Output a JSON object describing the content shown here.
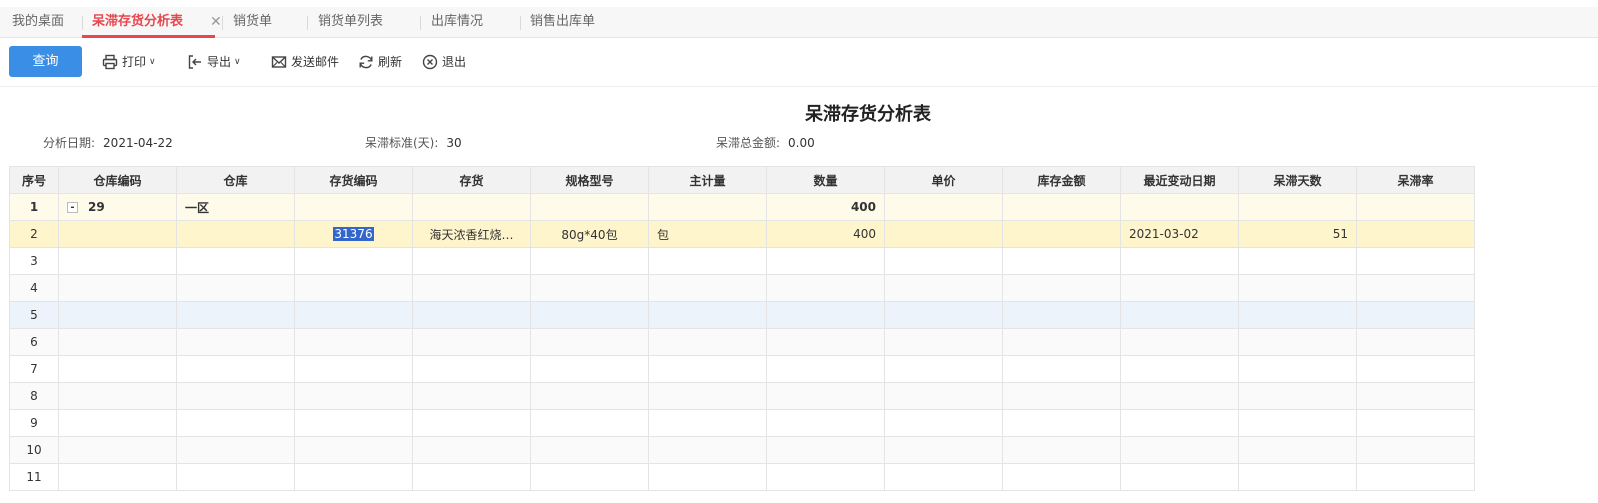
{
  "tabs": [
    {
      "label": "我的桌面",
      "active": false
    },
    {
      "label": "呆滞存货分析表",
      "active": true,
      "closable": true
    },
    {
      "label": "销货单",
      "active": false
    },
    {
      "label": "销货单列表",
      "active": false
    },
    {
      "label": "出库情况",
      "active": false
    },
    {
      "label": "销售出库单",
      "active": false
    }
  ],
  "close_glyph": "✕",
  "toolbar": {
    "query_label": "查询",
    "print_label": "打印",
    "export_label": "导出",
    "email_label": "发送邮件",
    "refresh_label": "刷新",
    "exit_label": "退出",
    "caret": "∨"
  },
  "report": {
    "title": "呆滞存货分析表",
    "analysis_date_label": "分析日期:",
    "analysis_date_value": "2021-04-22",
    "standard_label": "呆滞标准(天):",
    "standard_value": "30",
    "total_label": "呆滞总金额:",
    "total_value": "0.00"
  },
  "columns": [
    "序号",
    "仓库编码",
    "仓库",
    "存货编码",
    "存货",
    "规格型号",
    "主计量",
    "数量",
    "单价",
    "库存金额",
    "最近变动日期",
    "呆滞天数",
    "呆滞率"
  ],
  "rows": [
    {
      "seq": "1",
      "wh_code": "29",
      "wh": "一区",
      "item_code": "",
      "item": "",
      "spec": "",
      "unit": "",
      "qty": "400",
      "price": "",
      "amount": "",
      "last_date": "",
      "days": "",
      "rate": "",
      "toggle": "-"
    },
    {
      "seq": "2",
      "wh_code": "",
      "wh": "",
      "item_code": "31376",
      "item": "海天浓香红烧…",
      "spec": "80g*40包",
      "unit": "包",
      "qty": "400",
      "price": "",
      "amount": "",
      "last_date": "2021-03-02",
      "days": "51",
      "rate": ""
    },
    {
      "seq": "3"
    },
    {
      "seq": "4"
    },
    {
      "seq": "5"
    },
    {
      "seq": "6"
    },
    {
      "seq": "7"
    },
    {
      "seq": "8"
    },
    {
      "seq": "9"
    },
    {
      "seq": "10"
    },
    {
      "seq": "11"
    }
  ],
  "colors": {
    "accent": "#e8474f",
    "primary_button": "#3a8ee6",
    "link_blue": "#2323d6",
    "group_row": "#fffbea",
    "selected_row": "#fff5cc",
    "hover_row": "#edf3fb"
  }
}
